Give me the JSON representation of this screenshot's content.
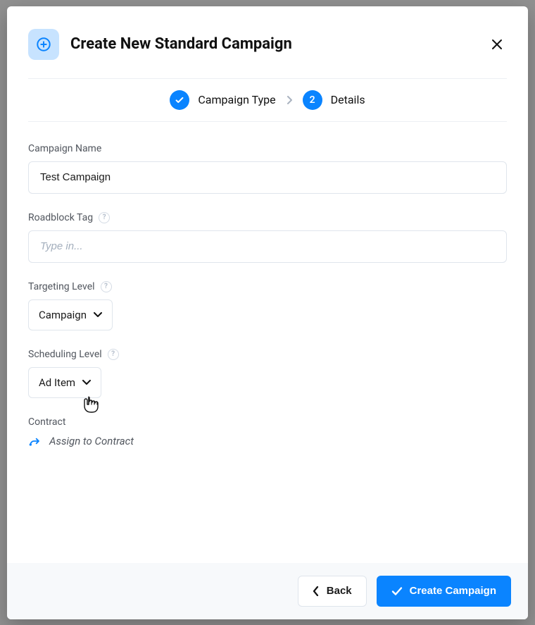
{
  "header": {
    "title": "Create New Standard Campaign"
  },
  "stepper": {
    "step1_label": "Campaign Type",
    "step2_number": "2",
    "step2_label": "Details"
  },
  "form": {
    "campaign_name": {
      "label": "Campaign Name",
      "value": "Test Campaign"
    },
    "roadblock_tag": {
      "label": "Roadblock Tag",
      "placeholder": "Type in..."
    },
    "targeting_level": {
      "label": "Targeting Level",
      "value": "Campaign"
    },
    "scheduling_level": {
      "label": "Scheduling Level",
      "value": "Ad Item"
    },
    "contract": {
      "label": "Contract",
      "link_text": "Assign to Contract"
    }
  },
  "footer": {
    "back_label": "Back",
    "primary_label": "Create Campaign"
  }
}
